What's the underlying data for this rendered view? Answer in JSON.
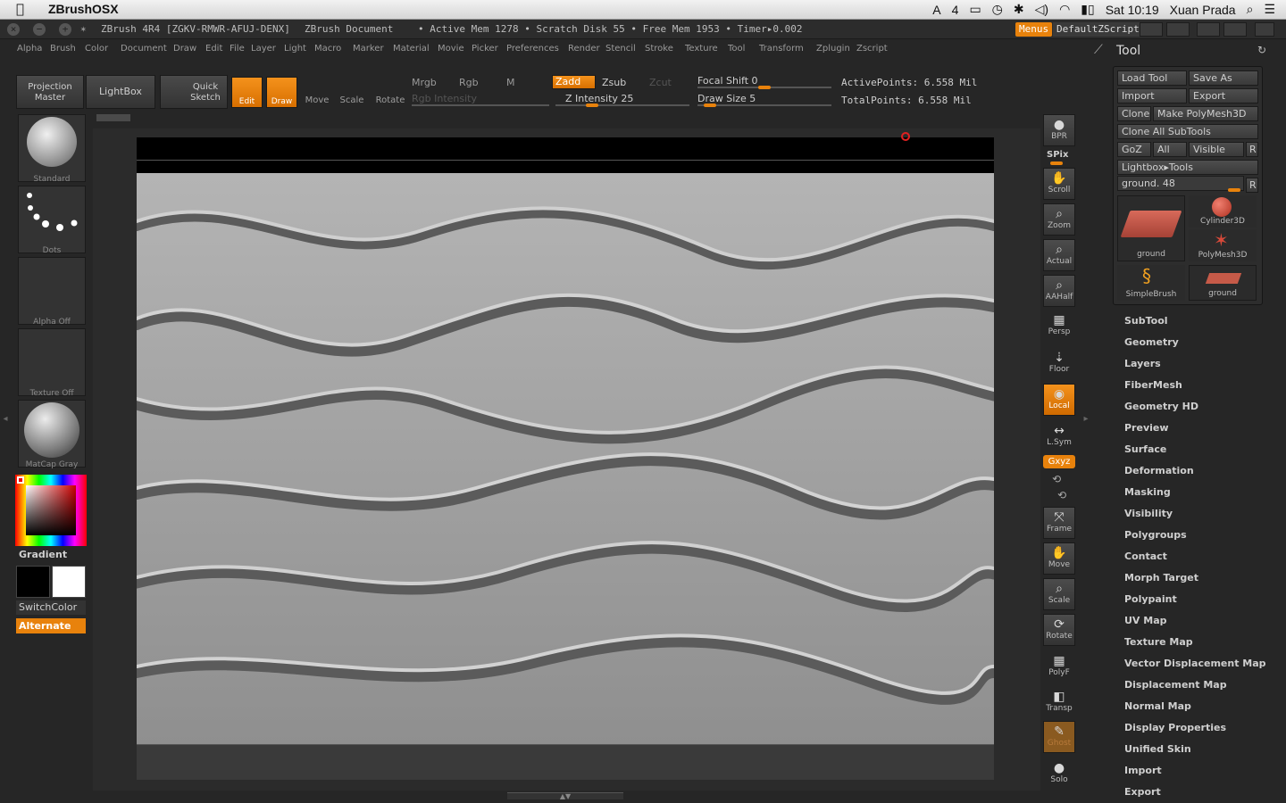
{
  "osbar": {
    "apple": "",
    "app_name": "ZBrushOSX",
    "adobe_badge": "4",
    "datetime": "Sat 10:19",
    "user": "Xuan Prada"
  },
  "titlebar": {
    "version": "ZBrush 4R4 [ZGKV-RMWR-AFUJ-DENX]",
    "document": "ZBrush Document",
    "stats": "• Active Mem 1278 • Scratch Disk 55 • Free Mem 1953 • Timer▸0.002",
    "menus": "Menus",
    "default_script": "DefaultZScript"
  },
  "menu": [
    "Alpha",
    "Brush",
    "Color",
    "Document",
    "Draw",
    "Edit",
    "File",
    "Layer",
    "Light",
    "Macro",
    "Marker",
    "Material",
    "Movie",
    "Picker",
    "Preferences",
    "Render",
    "Stencil",
    "Stroke",
    "Texture",
    "Tool",
    "Transform",
    "Zplugin",
    "Zscript"
  ],
  "shelf": {
    "projection_master": "Projection Master",
    "lightbox": "LightBox",
    "quick_sketch": "Quick Sketch",
    "edit": "Edit",
    "draw": "Draw",
    "move": "Move",
    "scale": "Scale",
    "rotate": "Rotate",
    "mrgb": "Mrgb",
    "rgb": "Rgb",
    "m": "M",
    "rgb_intensity": "Rgb Intensity",
    "zadd": "Zadd",
    "zsub": "Zsub",
    "zcut": "Zcut",
    "z_intensity": "Z Intensity 25",
    "focal_shift": "Focal Shift 0",
    "draw_size": "Draw Size 5",
    "active_points": "ActivePoints: 6.558 Mil",
    "total_points": "TotalPoints: 6.558 Mil"
  },
  "sliders": {
    "z_intensity": 0.25,
    "focal_shift": 0.5,
    "draw_size": 0.05
  },
  "left_panel": {
    "brush": "Standard",
    "stroke": "Dots",
    "alpha": "Alpha Off",
    "texture": "Texture Off",
    "material": "MatCap Gray",
    "gradient": "Gradient",
    "switch_color": "SwitchColor",
    "alternate": "Alternate"
  },
  "right_shelf": [
    {
      "name": "bpr",
      "label": "BPR",
      "icon": "●"
    },
    {
      "name": "scroll",
      "label": "Scroll",
      "icon": "✋"
    },
    {
      "name": "zoom",
      "label": "Zoom",
      "icon": "⌕"
    },
    {
      "name": "actual",
      "label": "Actual",
      "icon": "⌕"
    },
    {
      "name": "aahalf",
      "label": "AAHalf",
      "icon": "⌕"
    },
    {
      "name": "persp",
      "label": "Persp",
      "icon": "▦"
    },
    {
      "name": "floor",
      "label": "Floor",
      "icon": "⇣"
    },
    {
      "name": "local",
      "label": "Local",
      "icon": "◉"
    },
    {
      "name": "lsym",
      "label": "L.Sym",
      "icon": "↔"
    },
    {
      "name": "frame",
      "label": "Frame",
      "icon": "⤧"
    },
    {
      "name": "move",
      "label": "Move",
      "icon": "✋"
    },
    {
      "name": "scale",
      "label": "Scale",
      "icon": "⌕"
    },
    {
      "name": "rotate",
      "label": "Rotate",
      "icon": "⟳"
    },
    {
      "name": "polyf",
      "label": "PolyF",
      "icon": "▦"
    },
    {
      "name": "transp",
      "label": "Transp",
      "icon": "◧"
    },
    {
      "name": "ghost",
      "label": "Ghost",
      "icon": "✎"
    },
    {
      "name": "solo",
      "label": "Solo",
      "icon": "●"
    }
  ],
  "right_misc": {
    "spix": "SPix",
    "xyz": "Gxyz"
  },
  "tool": {
    "title": "Tool",
    "load_tool": "Load Tool",
    "save_as": "Save As",
    "import": "Import",
    "export": "Export",
    "clone": "Clone",
    "make_polymesh": "Make PolyMesh3D",
    "clone_all": "Clone All SubTools",
    "goz": "GoZ",
    "all": "All",
    "visible": "Visible",
    "r": "R",
    "lightbox_tools": "Lightbox▸Tools",
    "current": "ground. 48",
    "thumbs": [
      "ground",
      "Cylinder3D",
      "PolyMesh3D",
      "SimpleBrush",
      "ground"
    ]
  },
  "subpalettes": [
    "SubTool",
    "Geometry",
    "Layers",
    "FiberMesh",
    "Geometry HD",
    "Preview",
    "Surface",
    "Deformation",
    "Masking",
    "Visibility",
    "Polygroups",
    "Contact",
    "Morph Target",
    "Polypaint",
    "UV Map",
    "Texture Map",
    "Vector Displacement Map",
    "Displacement Map",
    "Normal Map",
    "Display Properties",
    "Unified Skin",
    "Import",
    "Export"
  ],
  "colors": {
    "accent": "#e8820c",
    "bg": "#262626",
    "panel": "#2d2d2d"
  }
}
